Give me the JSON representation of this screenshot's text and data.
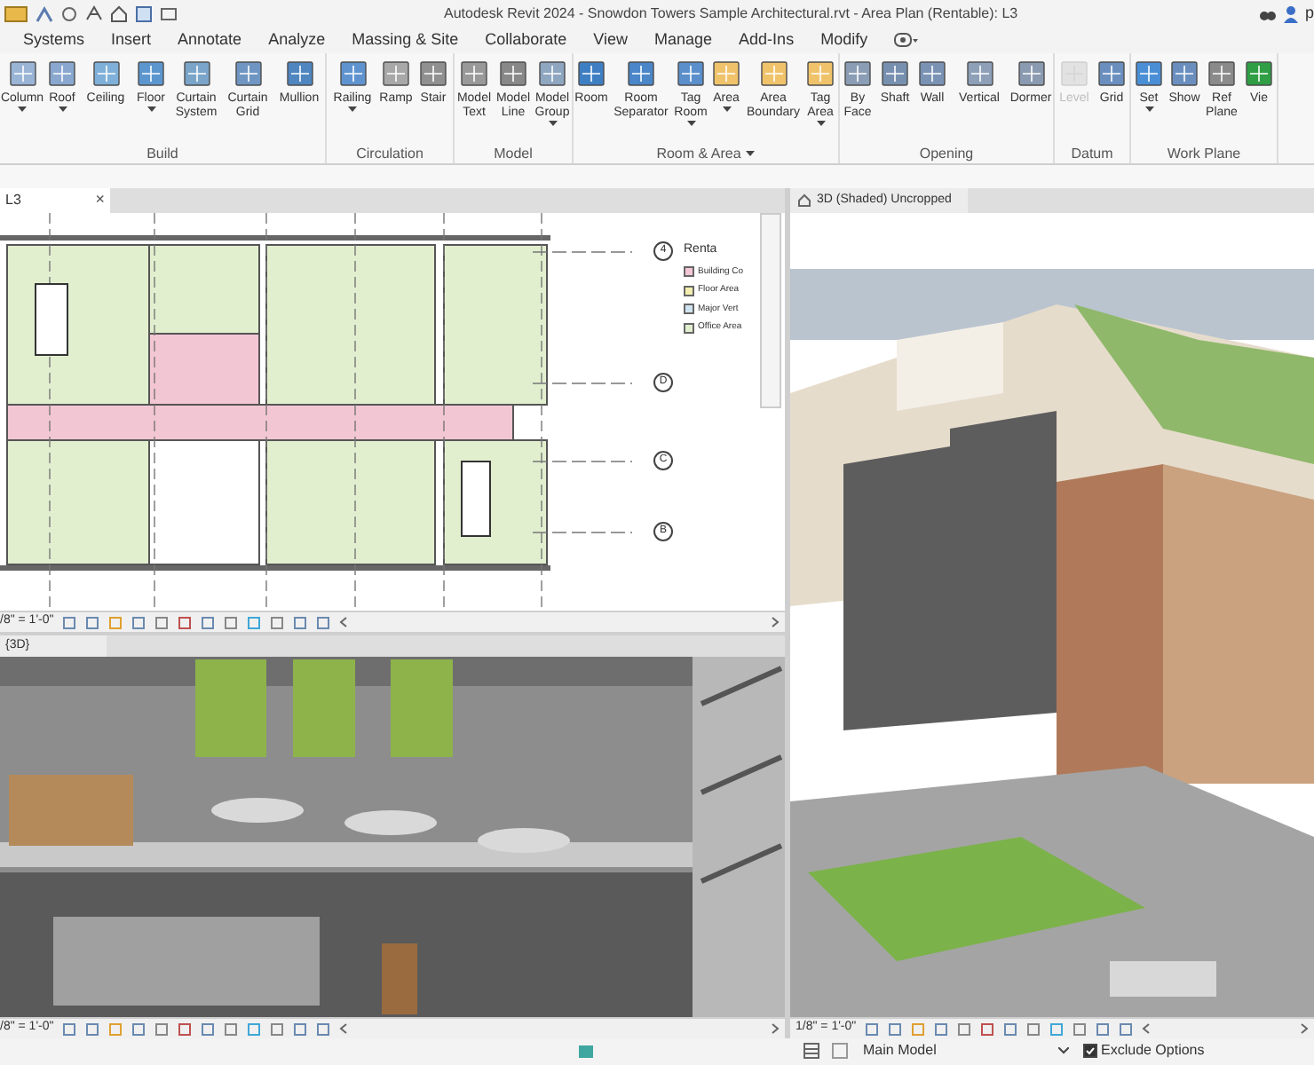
{
  "window": {
    "title": "Autodesk Revit 2024 - Snowdon Towers Sample Architectural.rvt - Area Plan (Rentable): L3",
    "user": "p"
  },
  "ribbon_tabs": [
    {
      "label": "Systems",
      "selected": false
    },
    {
      "label": "Insert",
      "selected": false
    },
    {
      "label": "Annotate",
      "selected": false
    },
    {
      "label": "Analyze",
      "selected": false
    },
    {
      "label": "Massing & Site",
      "selected": false
    },
    {
      "label": "Collaborate",
      "selected": false
    },
    {
      "label": "View",
      "selected": false
    },
    {
      "label": "Manage",
      "selected": false
    },
    {
      "label": "Add-Ins",
      "selected": false
    },
    {
      "label": "Modify",
      "selected": false
    }
  ],
  "ribbon_panels": [
    {
      "label": "Build",
      "has_menu": false,
      "tools": [
        {
          "label": "Column",
          "has_menu": true,
          "disabled": false
        },
        {
          "label": "Roof",
          "has_menu": true,
          "disabled": false
        },
        {
          "label": "Ceiling",
          "has_menu": false,
          "disabled": false
        },
        {
          "label": "Floor",
          "has_menu": true,
          "disabled": false
        },
        {
          "label": "Curtain System",
          "has_menu": false,
          "disabled": false
        },
        {
          "label": "Curtain Grid",
          "has_menu": false,
          "disabled": false
        },
        {
          "label": "Mullion",
          "has_menu": false,
          "disabled": false
        }
      ]
    },
    {
      "label": "Circulation",
      "has_menu": false,
      "tools": [
        {
          "label": "Railing",
          "has_menu": true,
          "disabled": false
        },
        {
          "label": "Ramp",
          "has_menu": false,
          "disabled": false
        },
        {
          "label": "Stair",
          "has_menu": false,
          "disabled": false
        }
      ]
    },
    {
      "label": "Model",
      "has_menu": false,
      "tools": [
        {
          "label": "Model Text",
          "has_menu": false,
          "disabled": false
        },
        {
          "label": "Model Line",
          "has_menu": false,
          "disabled": false
        },
        {
          "label": "Model Group",
          "has_menu": true,
          "disabled": false
        }
      ]
    },
    {
      "label": "Room & Area",
      "has_menu": true,
      "tools": [
        {
          "label": "Room",
          "has_menu": false,
          "disabled": false
        },
        {
          "label": "Room Separator",
          "has_menu": false,
          "disabled": false
        },
        {
          "label": "Tag Room",
          "has_menu": true,
          "disabled": false
        },
        {
          "label": "Area",
          "has_menu": true,
          "disabled": false
        },
        {
          "label": "Area Boundary",
          "has_menu": false,
          "disabled": false
        },
        {
          "label": "Tag Area",
          "has_menu": true,
          "disabled": false
        }
      ]
    },
    {
      "label": "Opening",
      "has_menu": false,
      "tools": [
        {
          "label": "By Face",
          "has_menu": false,
          "disabled": false
        },
        {
          "label": "Shaft",
          "has_menu": false,
          "disabled": false
        },
        {
          "label": "Wall",
          "has_menu": false,
          "disabled": false
        },
        {
          "label": "Vertical",
          "has_menu": false,
          "disabled": false
        },
        {
          "label": "Dormer",
          "has_menu": false,
          "disabled": false
        }
      ]
    },
    {
      "label": "Datum",
      "has_menu": false,
      "tools": [
        {
          "label": "Level",
          "has_menu": false,
          "disabled": true
        },
        {
          "label": "Grid",
          "has_menu": false,
          "disabled": false
        }
      ]
    },
    {
      "label": "Work Plane",
      "has_menu": false,
      "tools": [
        {
          "label": "Set",
          "has_menu": true,
          "disabled": false
        },
        {
          "label": "Show",
          "has_menu": false,
          "disabled": false
        },
        {
          "label": "Ref Plane",
          "has_menu": false,
          "disabled": false
        },
        {
          "label": "Vie",
          "has_menu": false,
          "disabled": false
        }
      ]
    }
  ],
  "plan_view": {
    "tab": "L3",
    "close": "×",
    "grid_labels": [
      "4",
      "D",
      "C",
      "B"
    ],
    "legend": {
      "title": "Renta",
      "items": [
        {
          "label": "Building Co",
          "color": "#f3c6d3"
        },
        {
          "label": "Floor Area",
          "color": "#f4eeb0"
        },
        {
          "label": "Major Vert",
          "color": "#cfe3f0"
        },
        {
          "label": "Office Area",
          "color": "#e2efcf"
        }
      ]
    },
    "scale": "/8\" = 1'-0\""
  },
  "section_view": {
    "tab": "{3D}",
    "scale": "/8\" = 1'-0\"",
    "kind": "picture"
  },
  "shaded_view": {
    "tab": "3D (Shaded) Uncropped",
    "scale": "1/8\" = 1'-0\"",
    "kind": "picture"
  },
  "status_bar": {
    "model": "Main Model",
    "exclude_options": {
      "label": "Exclude Options",
      "checked": true
    }
  }
}
